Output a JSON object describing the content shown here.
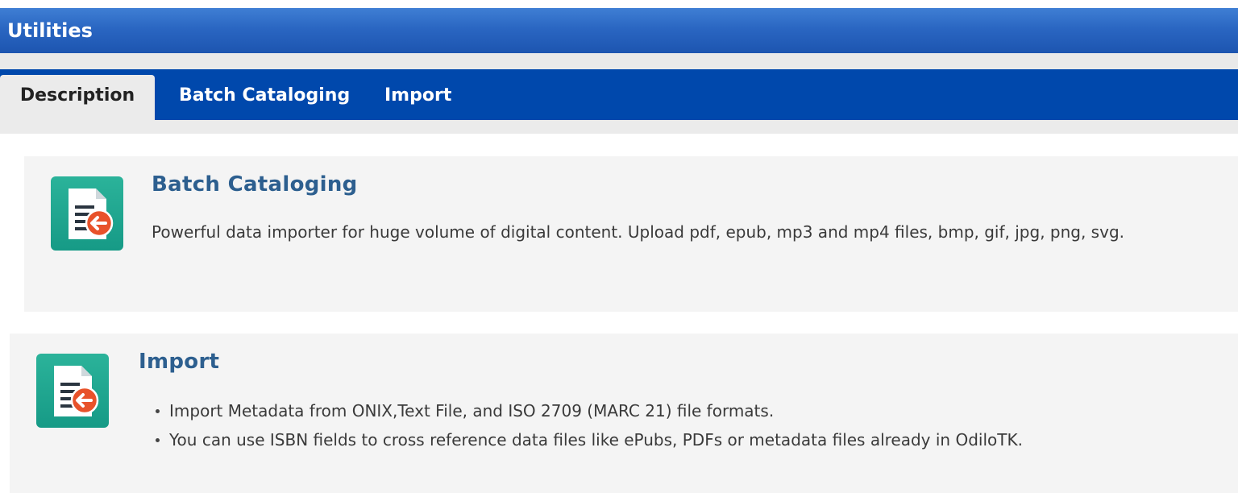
{
  "window": {
    "title": "Utilities"
  },
  "tabs": [
    {
      "label": "Description",
      "active": true
    },
    {
      "label": "Batch Cataloging",
      "active": false
    },
    {
      "label": "Import",
      "active": false
    }
  ],
  "sections": {
    "batch": {
      "icon": "document-import-icon",
      "title": "Batch Cataloging",
      "description": "Powerful data importer for huge volume of digital content. Upload pdf, epub, mp3 and mp4 files, bmp, gif, jpg, png, svg."
    },
    "import": {
      "icon": "document-import-icon",
      "title": "Import",
      "bullets": [
        "Import Metadata from ONIX,Text File, and ISO 2709 (MARC 21) file formats.",
        "You can use ISBN fields to cross reference data files like ePubs, PDFs or metadata files already in OdiloTK."
      ]
    }
  },
  "colors": {
    "title_bar": "#2a66c2",
    "tab_bar": "#0048ac",
    "section_title": "#2d5f8f",
    "icon_bg": "#169a86",
    "icon_arrow": "#e8522a"
  }
}
